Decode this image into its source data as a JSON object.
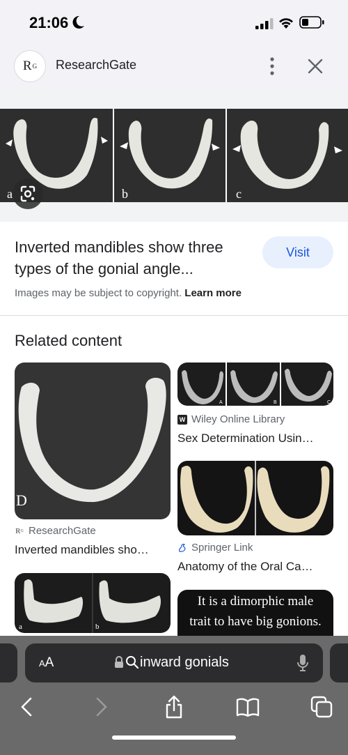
{
  "status": {
    "time": "21:06"
  },
  "header": {
    "logo_text": "R",
    "logo_sup": "G",
    "site_name": "ResearchGate"
  },
  "hero": {
    "labels": [
      "a",
      "b",
      "c"
    ]
  },
  "result": {
    "title": "Inverted mandibles show three types of the gonial angle...",
    "visit_label": "Visit",
    "copyright_text": "Images may be subject to copyright.",
    "learn_more": "Learn more"
  },
  "related": {
    "heading": "Related content",
    "cards": [
      {
        "source": "ResearchGate",
        "caption": "Inverted mandibles sho…",
        "source_icon": "Rᴳ"
      },
      {
        "source": "Wiley Online Library",
        "caption": "Sex Determination Usin…",
        "source_icon": "W"
      },
      {
        "source": "Springer Link",
        "caption": "Anatomy of the Oral Ca…",
        "source_icon": "springer-icon"
      },
      {
        "labels": [
          "a",
          "b"
        ]
      },
      {
        "meme_line1": "It is a dimorphic male",
        "meme_line2": "trait to have big gonions."
      }
    ],
    "thumb_labels": [
      "A",
      "B",
      "C"
    ],
    "big_card_letter": "D"
  },
  "toolbar": {
    "aa_small": "A",
    "aa_big": "A",
    "url": "inward gonials"
  }
}
